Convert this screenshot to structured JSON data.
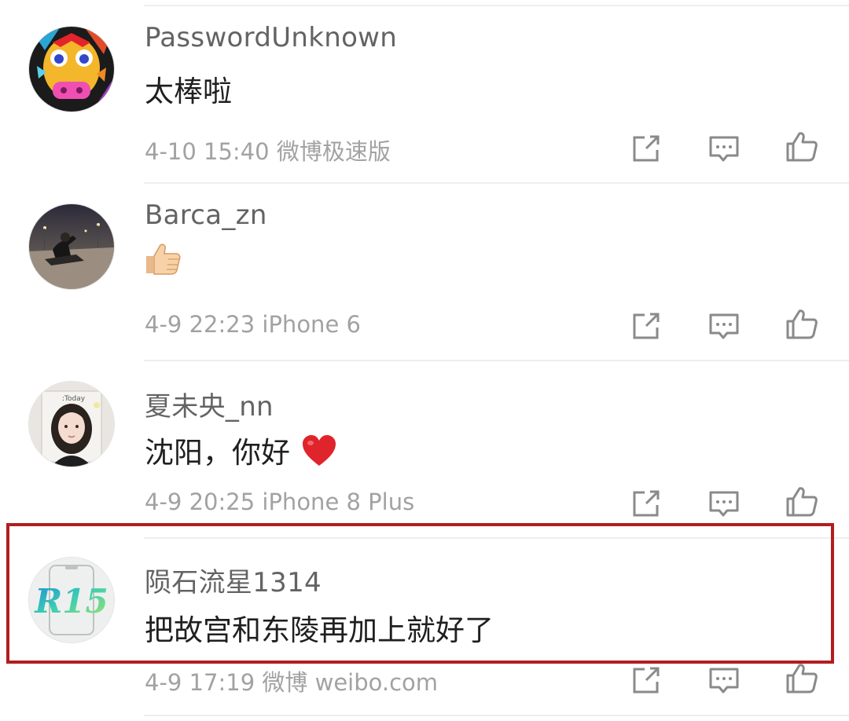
{
  "comments": [
    {
      "username": "PasswordUnknown",
      "content": "太棒啦",
      "time": "4-10 15:40",
      "source": "微博极速版",
      "avatar_icon": "colorful-cartoon-avatar"
    },
    {
      "username": "Barca_zn",
      "content": "",
      "content_emoji": "thumbs-up-emoji",
      "time": "4-9 22:23",
      "source": "iPhone 6",
      "avatar_icon": "night-road-photo-avatar"
    },
    {
      "username": "夏未央_nn",
      "content": "沈阳，你好",
      "content_emoji": "heart-emoji",
      "time": "4-9 20:25",
      "source": "iPhone 8 Plus",
      "avatar_icon": "girl-photo-avatar"
    },
    {
      "username": "陨石流星1314",
      "content": "把故宫和东陵再加上就好了",
      "time": "4-9 17:19",
      "source": "微博 weibo.com",
      "avatar_icon": "r15-logo-avatar",
      "avatar_text": "R15"
    }
  ],
  "actions": {
    "share_icon": "share-icon",
    "comment_icon": "comment-icon",
    "like_icon": "like-icon"
  },
  "colors": {
    "highlight_border": "#b11e1e",
    "meta_text": "#a2a2a2",
    "username_text": "#636363",
    "content_text": "#1f1f1f",
    "icon_stroke": "#8a8a8a"
  }
}
